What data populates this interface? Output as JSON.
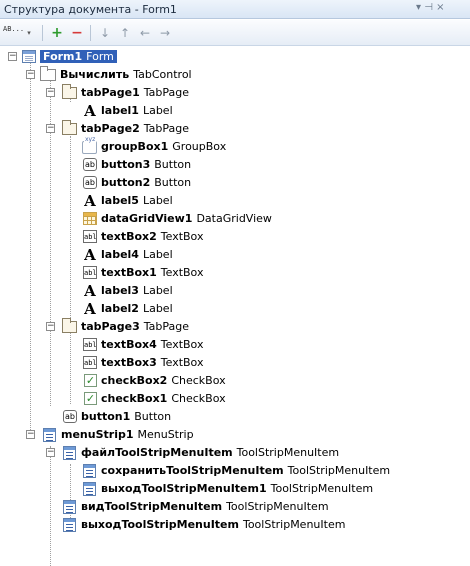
{
  "window": {
    "title": "Структура документа - Form1",
    "controls": "▾ ⊣ ×"
  },
  "toolbar": {
    "sort_label": "AB...",
    "add": "+",
    "remove": "−",
    "move_down": "↓",
    "move_up": "↑",
    "move_left": "←",
    "move_right": "→"
  },
  "tree": {
    "form": {
      "name": "Form1",
      "type": "Form"
    },
    "tabcontrol": {
      "name": "Вычислить",
      "type": "TabControl"
    },
    "tabpage1": {
      "name": "tabPage1",
      "type": "TabPage"
    },
    "label1": {
      "name": "label1",
      "type": "Label"
    },
    "tabpage2": {
      "name": "tabPage2",
      "type": "TabPage"
    },
    "groupbox1": {
      "name": "groupBox1",
      "type": "GroupBox"
    },
    "button3": {
      "name": "button3",
      "type": "Button"
    },
    "button2": {
      "name": "button2",
      "type": "Button"
    },
    "label5": {
      "name": "label5",
      "type": "Label"
    },
    "datagridview1": {
      "name": "dataGridView1",
      "type": "DataGridView"
    },
    "textbox2": {
      "name": "textBox2",
      "type": "TextBox"
    },
    "label4": {
      "name": "label4",
      "type": "Label"
    },
    "textbox1": {
      "name": "textBox1",
      "type": "TextBox"
    },
    "label3": {
      "name": "label3",
      "type": "Label"
    },
    "label2": {
      "name": "label2",
      "type": "Label"
    },
    "tabpage3": {
      "name": "tabPage3",
      "type": "TabPage"
    },
    "textbox4": {
      "name": "textBox4",
      "type": "TextBox"
    },
    "textbox3": {
      "name": "textBox3",
      "type": "TextBox"
    },
    "checkbox2": {
      "name": "checkBox2",
      "type": "CheckBox"
    },
    "checkbox1": {
      "name": "checkBox1",
      "type": "CheckBox"
    },
    "button1": {
      "name": "button1",
      "type": "Button"
    },
    "menustrip1": {
      "name": "menuStrip1",
      "type": "MenuStrip"
    },
    "file_item": {
      "name": "файлToolStripMenuItem",
      "type": "ToolStripMenuItem"
    },
    "save_item": {
      "name": "сохранитьToolStripMenuItem",
      "type": "ToolStripMenuItem"
    },
    "exit_item1": {
      "name": "выходToolStripMenuItem1",
      "type": "ToolStripMenuItem"
    },
    "view_item": {
      "name": "видToolStripMenuItem",
      "type": "ToolStripMenuItem"
    },
    "exit_item": {
      "name": "выходToolStripMenuItem",
      "type": "ToolStripMenuItem"
    }
  },
  "icon_glyphs": {
    "label": "A",
    "button": "ab",
    "textbox": "abl",
    "checkbox": "✓",
    "expander": "−"
  }
}
